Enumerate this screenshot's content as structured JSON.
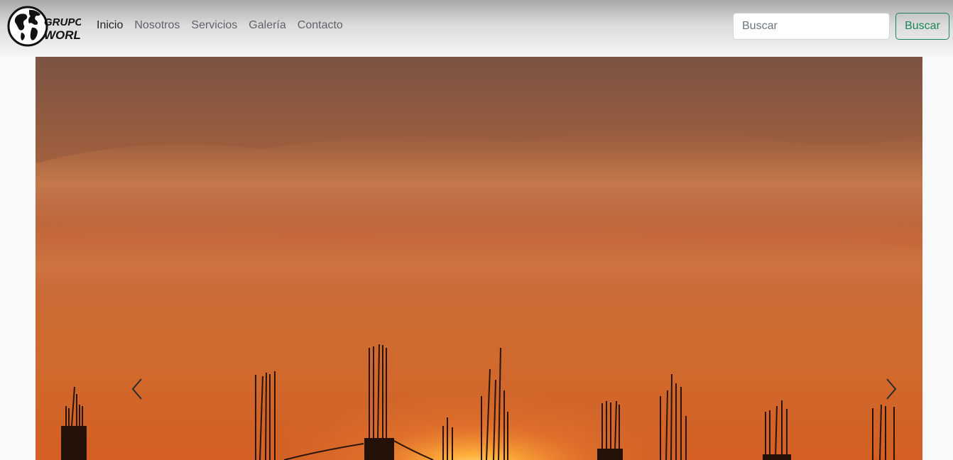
{
  "brand": {
    "logo_text_line1": "GRUPO",
    "logo_text_line2": "WORLD"
  },
  "nav": {
    "items": [
      {
        "label": "Inicio",
        "active": true
      },
      {
        "label": "Nosotros",
        "active": false
      },
      {
        "label": "Servicios",
        "active": false
      },
      {
        "label": "Galería",
        "active": false
      },
      {
        "label": "Contacto",
        "active": false
      }
    ]
  },
  "search": {
    "placeholder": "Buscar",
    "value": "",
    "button_label": "Buscar"
  },
  "carousel": {
    "slide_image": "sunset-construction-rebar-silhouette",
    "prev_icon": "chevron-left-icon",
    "next_icon": "chevron-right-icon"
  },
  "colors": {
    "accent_green": "#198754",
    "sky_top": "#7e5541",
    "sky_glow": "#e07a2c"
  }
}
